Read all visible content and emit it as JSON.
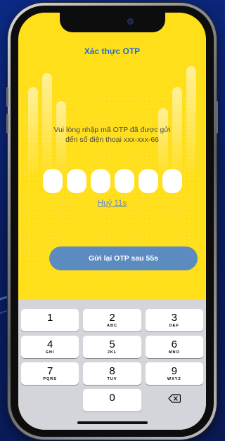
{
  "header": {
    "title": "Xác thực OTP"
  },
  "message": {
    "line1": "Vui lòng nhập mã OTP đã được gửi",
    "line2": "đến số điện thoại xxx-xxx-66"
  },
  "otp": {
    "digits": [
      "",
      "",
      "",
      "",
      "",
      ""
    ]
  },
  "cancel": {
    "label": "Huỷ 11s"
  },
  "resend": {
    "label": "Gửi lại OTP sau 55s"
  },
  "keypad": {
    "keys": [
      {
        "num": "1",
        "letters": ""
      },
      {
        "num": "2",
        "letters": "ABC"
      },
      {
        "num": "3",
        "letters": "DEF"
      },
      {
        "num": "4",
        "letters": "GHI"
      },
      {
        "num": "5",
        "letters": "JKL"
      },
      {
        "num": "6",
        "letters": "MNO"
      },
      {
        "num": "7",
        "letters": "PQRS"
      },
      {
        "num": "8",
        "letters": "TUV"
      },
      {
        "num": "9",
        "letters": "WXYZ"
      },
      {
        "num": "0",
        "letters": ""
      }
    ],
    "delete_icon": "backspace-icon"
  },
  "colors": {
    "screen_background": "#ffde1a",
    "title": "#1f6fd6",
    "resend_button": "#5b8bbf",
    "keyboard": "#d3d5da"
  }
}
